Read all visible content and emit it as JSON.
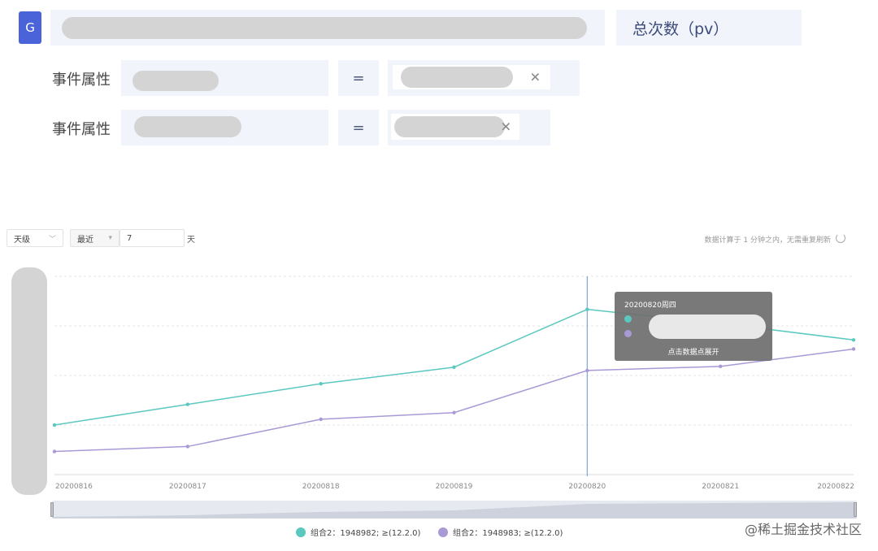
{
  "badge": "G",
  "metric": "总次数（pv）",
  "filters": [
    {
      "label": "事件属性",
      "operator": "=",
      "close": "✕"
    },
    {
      "label": "事件属性",
      "operator": "=",
      "close": "✕"
    }
  ],
  "controls": {
    "granularity": "天级",
    "range_mode": "最近",
    "range_value": "7",
    "unit": "天",
    "status": "数据计算于 1 分钟之内，无需重复刷新"
  },
  "tooltip": {
    "title": "20200820周四",
    "hint": "点击数据点展开"
  },
  "colors": {
    "series1": "#5bc8c0",
    "series2": "#a99ad6",
    "accent": "#4b63d8"
  },
  "chart_data": {
    "type": "line",
    "x": [
      "20200816",
      "20200817",
      "20200818",
      "20200819",
      "20200820",
      "20200821",
      "20200822"
    ],
    "series": [
      {
        "name": "组合2：1948982; ≥(12.2.0)",
        "values": [
          60,
          85,
          110,
          130,
          200,
          183,
          163
        ]
      },
      {
        "name": "组合2：1948983; ≥(12.2.0)",
        "values": [
          28,
          34,
          67,
          75,
          126,
          131,
          152
        ]
      }
    ],
    "ylim": [
      0,
      240
    ],
    "grid": true,
    "highlight_x": "20200820",
    "legend": "bottom"
  },
  "watermark": "@稀土掘金技术社区"
}
